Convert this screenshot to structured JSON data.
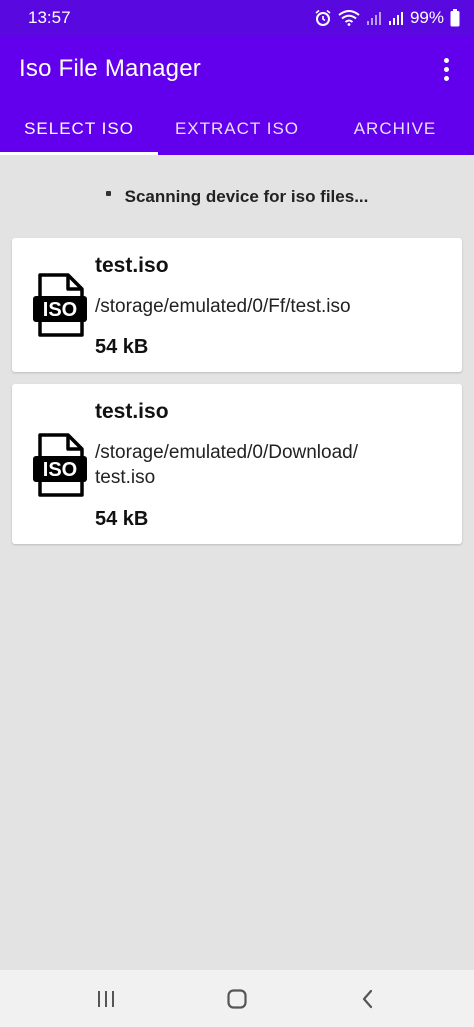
{
  "status_bar": {
    "time": "13:57",
    "battery": "99%"
  },
  "app_bar": {
    "title": "Iso File Manager"
  },
  "tabs": [
    {
      "label": "SELECT ISO",
      "selected": true
    },
    {
      "label": "EXTRACT ISO",
      "selected": false
    },
    {
      "label": "ARCHIVE",
      "selected": false
    }
  ],
  "scan_status": "Scanning device for iso files...",
  "files": [
    {
      "name": "test.iso",
      "path": "/storage/emulated/0/Ff/test.iso",
      "size": "54 kB",
      "icon": "iso-file-icon"
    },
    {
      "name": "test.iso",
      "path": "/storage/emulated/0/Download/\ntest.iso",
      "size": "54 kB",
      "icon": "iso-file-icon"
    }
  ],
  "colors": {
    "primary": "#6200ee",
    "status_bar": "#5a08e0",
    "background": "#e3e3e3"
  }
}
